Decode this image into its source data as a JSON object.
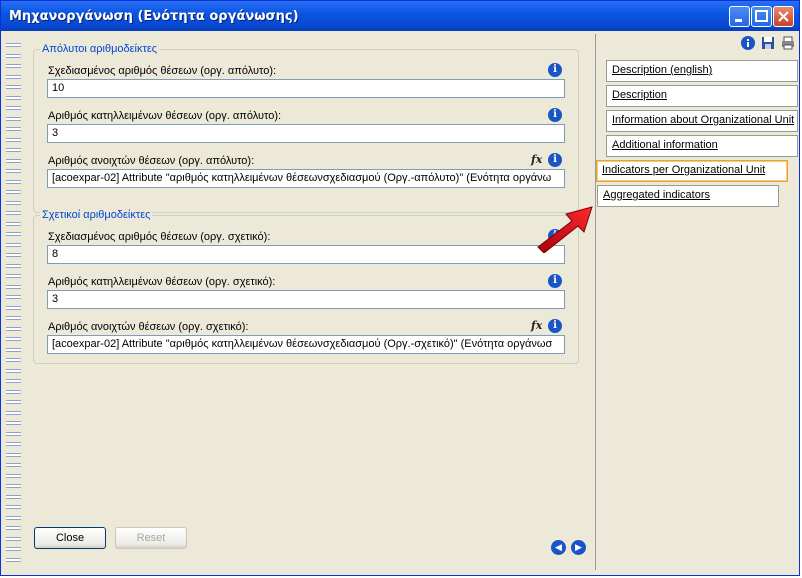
{
  "window": {
    "title": "Μηχανοργάνωση (Ενότητα οργάνωσης)"
  },
  "absolute_group": {
    "legend": "Απόλυτοι αριθμοδείκτες",
    "fields": [
      {
        "label": "Σχεδιασμένος αριθμός θέσεων (οργ. απόλυτο):",
        "value": "10"
      },
      {
        "label": "Αριθμός κατηλλειμένων θέσεων (οργ. απόλυτο):",
        "value": "3"
      },
      {
        "label": "Αριθμός ανοιχτών θέσεων (οργ. απόλυτο):",
        "value": "[acoexpar-02] Attribute \"αριθμός κατηλλειμένων θέσεωνσχεδιασμού (Οργ.-απόλυτο)\" (Ενότητα οργάνω"
      }
    ]
  },
  "relative_group": {
    "legend": "Σχετικοί αριθμοδείκτες",
    "fields": [
      {
        "label": "Σχεδιασμένος αριθμός θέσεων (οργ. σχετικό):",
        "value": "8"
      },
      {
        "label": "Αριθμός κατηλλειμένων θέσεων (οργ. σχετικό):",
        "value": "3"
      },
      {
        "label": "Αριθμός ανοιχτών θέσεων (οργ. σχετικό):",
        "value": "[acoexpar-02] Attribute \"αριθμός κατηλλειμένων θέσεωνσχεδιασμού (Οργ.-σχετικό)\" (Ενότητα οργάνωσ"
      }
    ]
  },
  "buttons": {
    "close": "Close",
    "reset": "Reset"
  },
  "icons": {
    "info": "i",
    "fx": "fx",
    "prev": "◀",
    "next": "▶"
  },
  "tabs": [
    {
      "label": "Description (english)",
      "active": false
    },
    {
      "label": "Description",
      "active": false
    },
    {
      "label": "Information about Organizational Unit",
      "active": false
    },
    {
      "label": "Additional information",
      "active": false
    },
    {
      "label": "Indicators per Organizational Unit",
      "active": true
    },
    {
      "label": "Aggregated indicators",
      "active": false
    }
  ],
  "colors": {
    "titlebar": "#0b56e4",
    "legend_text": "#0046d5",
    "active_tab_border": "#e8a23c",
    "arrow": "#d8101c"
  }
}
